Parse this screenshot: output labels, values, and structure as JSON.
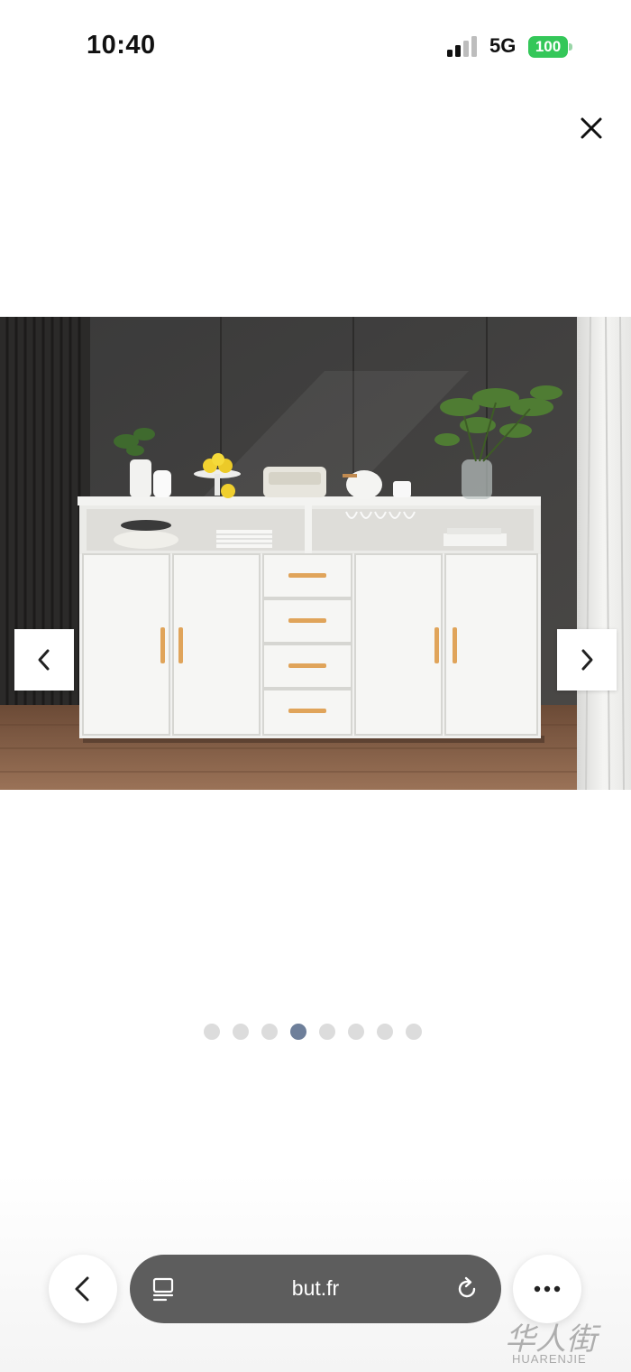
{
  "status_bar": {
    "time": "10:40",
    "network": "5G",
    "battery": "100"
  },
  "browser": {
    "url": "but.fr"
  },
  "gallery": {
    "slide_count": 8,
    "active_index": 3
  },
  "colors": {
    "accent_dot": "#6e7f9a",
    "battery": "#34c759",
    "url_bar": "#5d5d5d"
  },
  "icons": [
    "signal-icon",
    "battery-icon",
    "close-icon",
    "chevron-left-icon",
    "chevron-right-icon",
    "chevron-back-icon",
    "reader-icon",
    "reload-icon",
    "more-icon"
  ],
  "watermark": {
    "cn": "华人街",
    "en": "HUARENJIE"
  }
}
